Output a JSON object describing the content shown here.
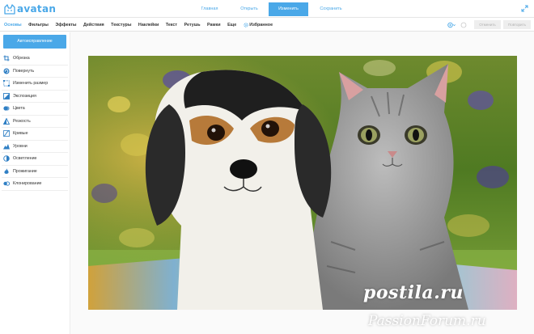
{
  "app": {
    "logo_text": "avatan"
  },
  "top_tabs": [
    {
      "label": "Главная",
      "active": false
    },
    {
      "label": "Открыть",
      "active": false
    },
    {
      "label": "Изменить",
      "active": true
    },
    {
      "label": "Сохранить",
      "active": false
    }
  ],
  "menu": {
    "items": [
      {
        "label": "Основы",
        "active": true
      },
      {
        "label": "Фильтры"
      },
      {
        "label": "Эффекты"
      },
      {
        "label": "Действия"
      },
      {
        "label": "Текстуры"
      },
      {
        "label": "Наклейки"
      },
      {
        "label": "Текст"
      },
      {
        "label": "Ретушь"
      },
      {
        "label": "Рамки"
      },
      {
        "label": "Еще"
      }
    ],
    "favorites_label": "Избранное",
    "undo_label": "Отменить",
    "redo_label": "Повторить"
  },
  "sidebar": {
    "auto_button": "Автоисправление",
    "tools": [
      {
        "label": "Обрезка",
        "icon": "crop-icon"
      },
      {
        "label": "Повернуть",
        "icon": "rotate-icon"
      },
      {
        "label": "Изменить размер",
        "icon": "resize-icon"
      },
      {
        "label": "Экспозиция",
        "icon": "exposure-icon"
      },
      {
        "label": "Цвета",
        "icon": "colors-icon"
      },
      {
        "label": "Резкость",
        "icon": "sharpness-icon"
      },
      {
        "label": "Кривые",
        "icon": "curves-icon"
      },
      {
        "label": "Уровни",
        "icon": "levels-icon"
      },
      {
        "label": "Осветление",
        "icon": "lighten-icon"
      },
      {
        "label": "Прожигание",
        "icon": "burn-icon"
      },
      {
        "label": "Клонирование",
        "icon": "clone-icon"
      }
    ]
  },
  "watermark": {
    "line1": "postila.ru",
    "line2": "PassionForum.ru"
  },
  "colors": {
    "accent": "#4aa8e8",
    "tool_icon": "#2f7fc4"
  }
}
